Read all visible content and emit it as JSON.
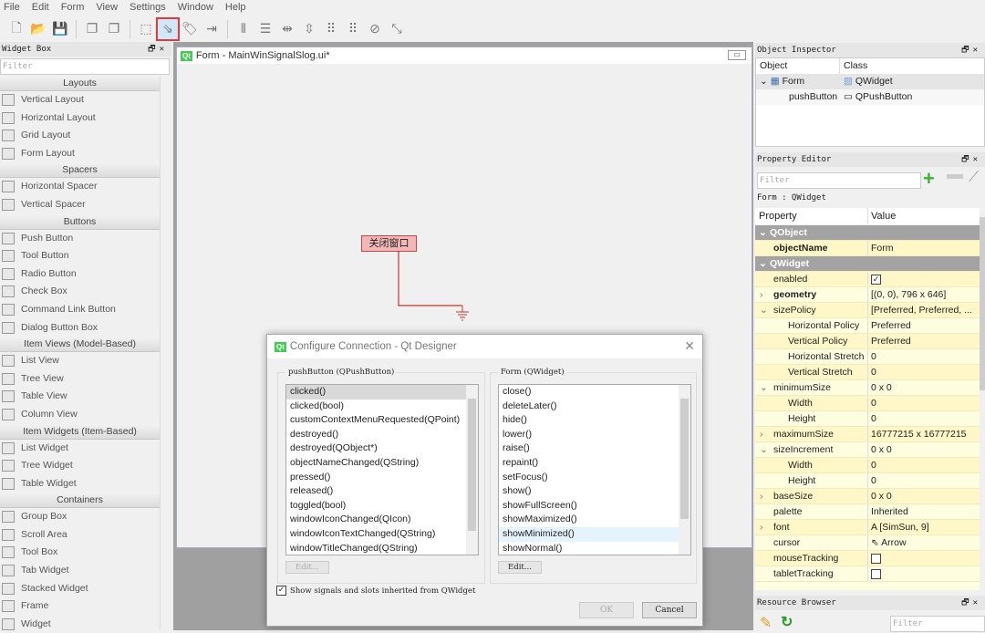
{
  "menu": [
    "File",
    "Edit",
    "Form",
    "View",
    "Settings",
    "Window",
    "Help"
  ],
  "toolbar": [
    {
      "icon": "new-file-icon",
      "glyph": "🗋"
    },
    {
      "icon": "open-folder-icon",
      "glyph": "📂"
    },
    {
      "icon": "save-icon",
      "glyph": "💾"
    },
    "sep",
    {
      "icon": "bring-forward-icon",
      "glyph": "❐"
    },
    {
      "icon": "send-back-icon",
      "glyph": "❐"
    },
    "sep",
    {
      "icon": "edit-widgets-icon",
      "glyph": "⬚"
    },
    {
      "icon": "edit-signals-slots-icon",
      "glyph": "⇘",
      "selected": true
    },
    {
      "icon": "edit-buddies-icon",
      "glyph": "🏷"
    },
    {
      "icon": "edit-tab-order-icon",
      "glyph": "⇥"
    },
    "sep",
    {
      "icon": "layout-horizontal-icon",
      "glyph": "⫴"
    },
    {
      "icon": "layout-vertical-icon",
      "glyph": "☰"
    },
    {
      "icon": "layout-h-splitter-icon",
      "glyph": "⇹"
    },
    {
      "icon": "layout-v-splitter-icon",
      "glyph": "⇳"
    },
    {
      "icon": "layout-grid-icon",
      "glyph": "⠿"
    },
    {
      "icon": "layout-form-icon",
      "glyph": "⠿"
    },
    {
      "icon": "break-layout-icon",
      "glyph": "⊘"
    },
    {
      "icon": "adjust-size-icon",
      "glyph": "⤡"
    }
  ],
  "widget_box": {
    "title": "Widget Box",
    "filter_placeholder": "Filter",
    "sections": [
      {
        "name": "Layouts",
        "items": [
          "Vertical Layout",
          "Horizontal Layout",
          "Grid Layout",
          "Form Layout"
        ]
      },
      {
        "name": "Spacers",
        "items": [
          "Horizontal Spacer",
          "Vertical Spacer"
        ]
      },
      {
        "name": "Buttons",
        "items": [
          "Push Button",
          "Tool Button",
          "Radio Button",
          "Check Box",
          "Command Link Button",
          "Dialog Button Box"
        ]
      },
      {
        "name": "Item Views (Model-Based)",
        "items": [
          "List View",
          "Tree View",
          "Table View",
          "Column View"
        ]
      },
      {
        "name": "Item Widgets (Item-Based)",
        "items": [
          "List Widget",
          "Tree Widget",
          "Table Widget"
        ]
      },
      {
        "name": "Containers",
        "items": [
          "Group Box",
          "Scroll Area",
          "Tool Box",
          "Tab Widget",
          "Stacked Widget",
          "Frame",
          "Widget"
        ]
      }
    ]
  },
  "form": {
    "title": "Form - MainWinSignalSlog.ui*",
    "push_button": "关闭窗口"
  },
  "dialog": {
    "title": "Configure Connection - Qt Designer",
    "left_label": "pushButton (QPushButton)",
    "signals": [
      "clicked()",
      "clicked(bool)",
      "customContextMenuRequested(QPoint)",
      "destroyed()",
      "destroyed(QObject*)",
      "objectNameChanged(QString)",
      "pressed()",
      "released()",
      "toggled(bool)",
      "windowIconChanged(QIcon)",
      "windowIconTextChanged(QString)",
      "windowTitleChanged(QString)"
    ],
    "selected_signal": "clicked()",
    "right_label": "Form (QWidget)",
    "slots": [
      "close()",
      "deleteLater()",
      "hide()",
      "lower()",
      "raise()",
      "repaint()",
      "setFocus()",
      "show()",
      "showFullScreen()",
      "showMaximized()",
      "showMinimized()",
      "showNormal()"
    ],
    "hovered_slot": "showMinimized()",
    "edit_label": "Edit...",
    "inherit_label": "Show signals and slots inherited from QWidget",
    "inherit_checked": true,
    "ok": "OK",
    "cancel": "Cancel"
  },
  "object_inspector": {
    "title": "Object Inspector",
    "headers": [
      "Object",
      "Class"
    ],
    "rows": [
      {
        "object": "Form",
        "class": "QWidget"
      },
      {
        "object": "pushButton",
        "class": "QPushButton"
      }
    ]
  },
  "property_editor": {
    "title": "Property Editor",
    "filter_placeholder": "Filter",
    "context": "Form : QWidget",
    "headers": [
      "Property",
      "Value"
    ],
    "rows": [
      {
        "g": "QObject"
      },
      {
        "p": "objectName",
        "v": "Form",
        "bold": true
      },
      {
        "g": "QWidget"
      },
      {
        "p": "enabled",
        "check": true
      },
      {
        "p": "geometry",
        "v": "[(0, 0), 796 x 646]",
        "bold": true,
        "exp": ">"
      },
      {
        "p": "sizePolicy",
        "v": "[Preferred, Preferred, ...",
        "exp": "v"
      },
      {
        "p": "Horizontal Policy",
        "v": "Preferred",
        "sub": true
      },
      {
        "p": "Vertical Policy",
        "v": "Preferred",
        "sub": true
      },
      {
        "p": "Horizontal Stretch",
        "v": "0",
        "sub": true
      },
      {
        "p": "Vertical Stretch",
        "v": "0",
        "sub": true
      },
      {
        "p": "minimumSize",
        "v": "0 x 0",
        "exp": "v"
      },
      {
        "p": "Width",
        "v": "0",
        "sub": true
      },
      {
        "p": "Height",
        "v": "0",
        "sub": true
      },
      {
        "p": "maximumSize",
        "v": "16777215 x 16777215",
        "exp": ">"
      },
      {
        "p": "sizeIncrement",
        "v": "0 x 0",
        "exp": "v"
      },
      {
        "p": "Width",
        "v": "0",
        "sub": true
      },
      {
        "p": "Height",
        "v": "0",
        "sub": true
      },
      {
        "p": "baseSize",
        "v": "0 x 0",
        "exp": ">"
      },
      {
        "p": "palette",
        "v": "Inherited"
      },
      {
        "p": "font",
        "v": "A  [SimSun, 9]",
        "exp": ">"
      },
      {
        "p": "cursor",
        "v": "⇖ Arrow"
      },
      {
        "p": "mouseTracking",
        "check": false
      },
      {
        "p": "tabletTracking",
        "check": false
      }
    ]
  },
  "resource_browser": {
    "title": "Resource Browser",
    "filter_placeholder": "Filter"
  }
}
